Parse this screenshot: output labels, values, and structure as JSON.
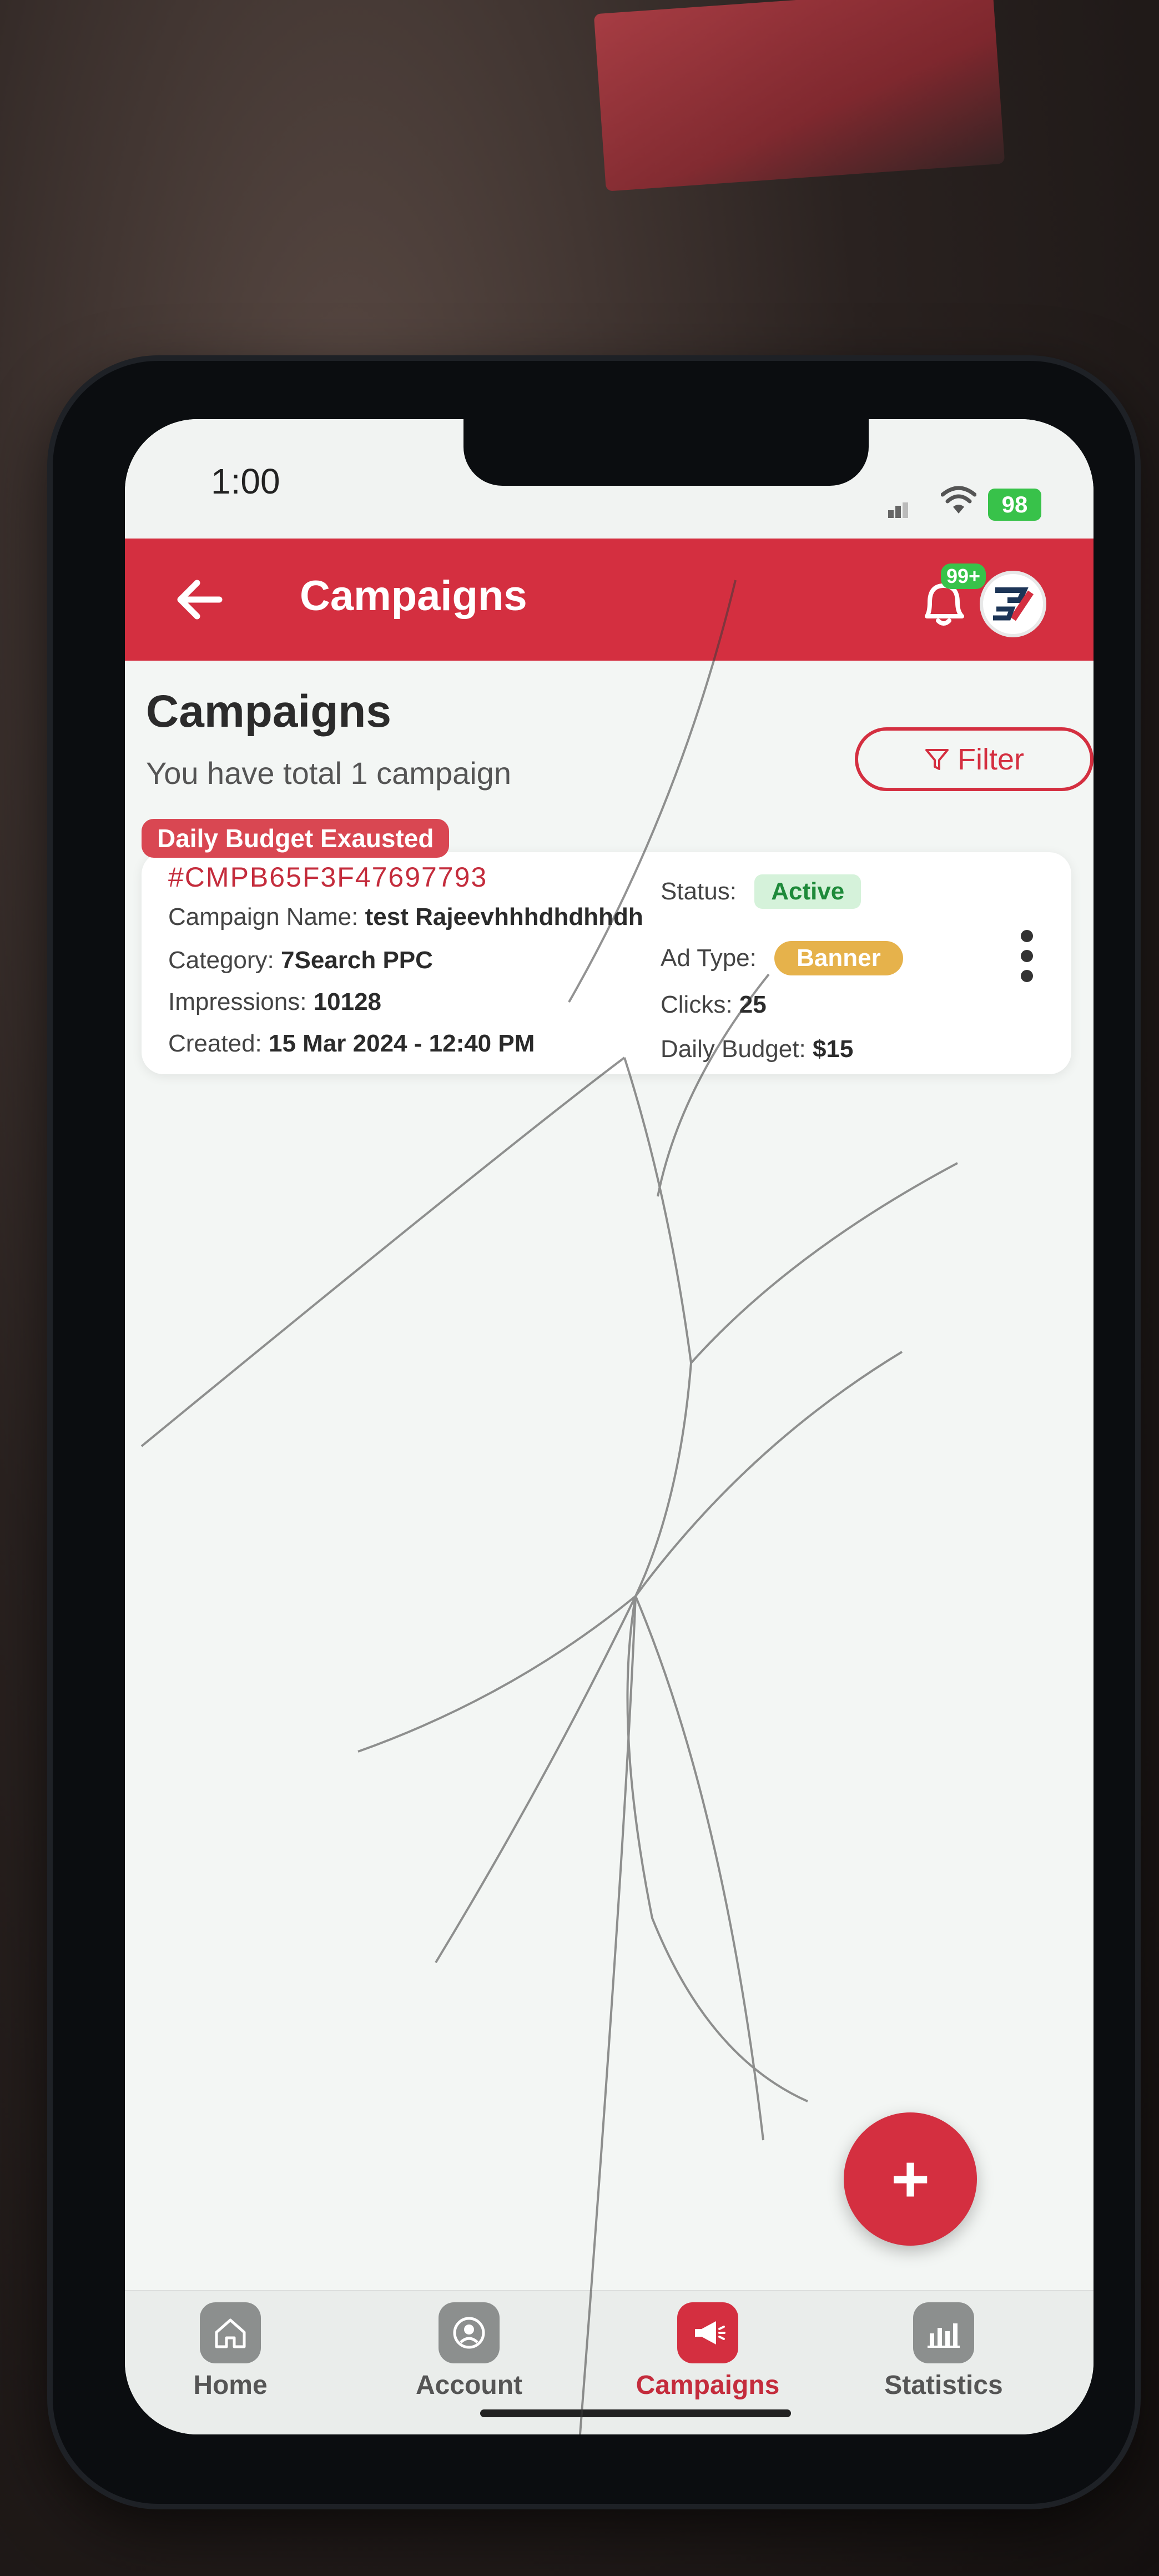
{
  "status_bar": {
    "time": "1:00",
    "battery": "98"
  },
  "app_bar": {
    "title": "Campaigns",
    "notification_count": "99+",
    "icons": {
      "back": "back-arrow-icon",
      "notifications": "bell-icon",
      "avatar": "brand-logo-icon"
    }
  },
  "header": {
    "title": "Campaigns",
    "subtitle": "You have total 1 campaign",
    "filter_label": "Filter"
  },
  "campaign": {
    "tag": "Daily Budget Exausted",
    "id": "#CMPB65F3F47697793",
    "name_label": "Campaign Name:",
    "name_value": "test Rajeevhhhdhdhhdh",
    "category_label": "Category:",
    "category_value": "7Search PPC",
    "impressions_label": "Impressions:",
    "impressions_value": "10128",
    "created_label": "Created:",
    "created_value": "15 Mar 2024 - 12:40 PM",
    "status_label": "Status:",
    "status_value": "Active",
    "adtype_label": "Ad Type:",
    "adtype_value": "Banner",
    "clicks_label": "Clicks:",
    "clicks_value": "25",
    "budget_label": "Daily Budget:",
    "budget_value": "$15"
  },
  "bottom_nav": {
    "items": [
      {
        "label": "Home",
        "icon": "home-icon"
      },
      {
        "label": "Account",
        "icon": "account-icon"
      },
      {
        "label": "Campaigns",
        "icon": "megaphone-icon"
      },
      {
        "label": "Statistics",
        "icon": "bar-chart-icon"
      }
    ],
    "active": "Campaigns"
  },
  "colors": {
    "brand": "#d42f40",
    "active_green": "#1e8a3a",
    "banner_yellow": "#e6b24b",
    "battery_green": "#38c24a"
  }
}
